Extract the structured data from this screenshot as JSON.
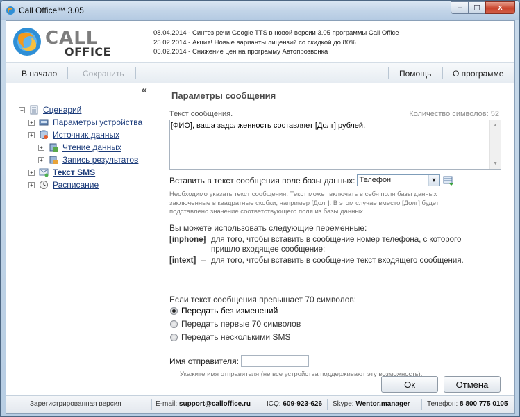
{
  "window": {
    "title": "Call Office™ 3.05",
    "min_label": "‒",
    "max_label": "☐",
    "close_label": "x"
  },
  "logo": {
    "line1": "CALL",
    "line2": "OFFICE"
  },
  "news": [
    "08.04.2014 - Синтез речи Google TTS в новой версии 3.05 программы Call Office",
    "25.02.2014 - Акция! Новые варианты лицензий со скидкой до 80%",
    "05.02.2014 - Снижение цен на программу Автопрозвонка"
  ],
  "toolbar": {
    "home": "В начало",
    "save": "Сохранить",
    "help": "Помощь",
    "about": "О программе"
  },
  "sidebar": {
    "collapse": "«",
    "items": [
      {
        "label": "Сценарий"
      },
      {
        "label": "Параметры устройства"
      },
      {
        "label": "Источник данных"
      },
      {
        "label": "Чтение данных"
      },
      {
        "label": "Запись результатов"
      },
      {
        "label": "Текст SMS"
      },
      {
        "label": "Расписание"
      }
    ]
  },
  "main": {
    "title": "Параметры сообщения",
    "message_label": "Текст сообщения.",
    "count_label": "Количество символов:",
    "count_value": "52",
    "message_text": "[ФИО], ваша задолженность составляет [Долг] рублей.",
    "insert_label": "Вставить в текст сообщения поле базы данных:",
    "insert_value": "Телефон",
    "help1": "Необходимо указать текст сообщения. Текст может включать в себя поля базы данных заключенные в квадратные скобки, например [Долг]. В этом случае вместо [Долг] будет подставлено значение соответствующего поля из базы данных.",
    "vars_title": "Вы можете использовать следующие переменные:",
    "vars": [
      {
        "key": "[inphone]",
        "dash": "–",
        "text": "для того, чтобы вставить в сообщение номер телефона, с которого пришло входящее сообщение;"
      },
      {
        "key": "[intext]",
        "dash": "–",
        "text": "для того, чтобы вставить в сообщение текст входящего сообщения."
      }
    ],
    "exceed_label": "Если текст сообщения превышает 70 символов:",
    "options": [
      {
        "label": "Передать без изменений",
        "selected": true
      },
      {
        "label": "Передать первые 70 символов",
        "selected": false
      },
      {
        "label": "Передать несколькими SMS",
        "selected": false
      }
    ],
    "sender_label": "Имя отправителя:",
    "sender_value": "",
    "help2": "Укажите имя отправителя (не все устройства поддерживают эту возможность)."
  },
  "buttons": {
    "ok": "Ок",
    "cancel": "Отмена"
  },
  "status": {
    "registered": "Зарегистрированная версия",
    "email_label": "E-mail:",
    "email": "support@calloffice.ru",
    "icq_label": "ICQ:",
    "icq": "609-923-626",
    "skype_label": "Skype:",
    "skype": "Wentor.manager",
    "phone_label": "Телефон:",
    "phone": "8 800 775 0105"
  },
  "colors": {
    "link": "#1b3b7a",
    "accent_orange": "#f39a1d",
    "accent_blue": "#2f8fd6"
  }
}
